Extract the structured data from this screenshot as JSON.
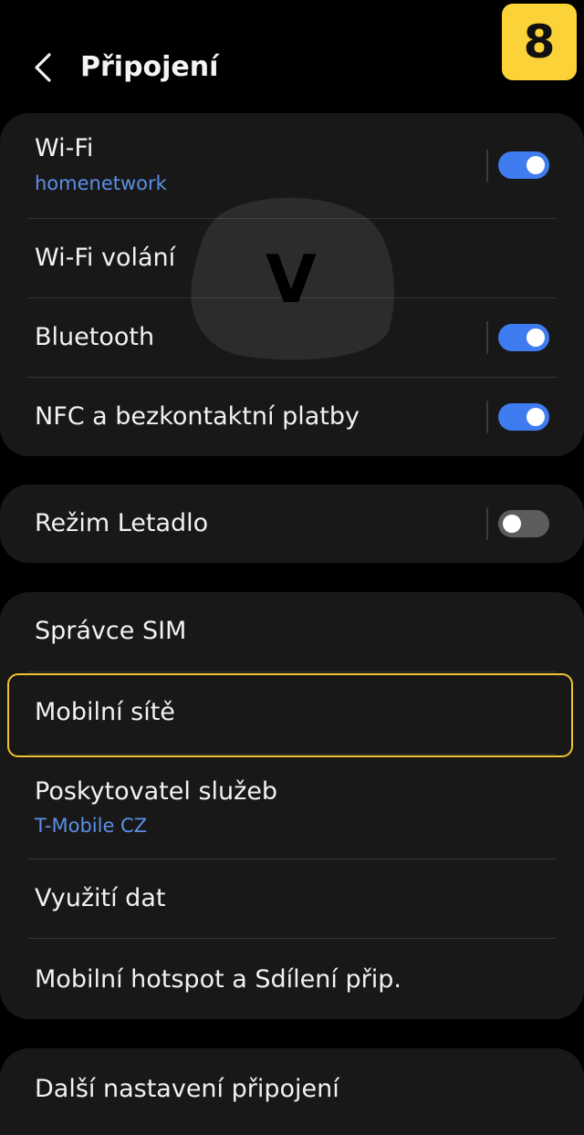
{
  "colors": {
    "background": "#000000",
    "card": "#181818",
    "accent_blue": "#3f7cf0",
    "subtext_blue": "#5b8fe6",
    "toggle_off": "#5c5c5c",
    "highlight": "#f2c232",
    "badge": "#fbd338"
  },
  "header": {
    "back_icon": "chevron-left-icon",
    "title": "Připojení"
  },
  "badge": {
    "step": "8"
  },
  "watermark": {
    "letter": "V"
  },
  "groups": [
    {
      "items": [
        {
          "label": "Wi-Fi",
          "sublabel": "homenetwork",
          "toggle": "on"
        },
        {
          "label": "Wi-Fi volání"
        },
        {
          "label": "Bluetooth",
          "toggle": "on"
        },
        {
          "label": "NFC a bezkontaktní platby",
          "toggle": "on"
        }
      ]
    },
    {
      "items": [
        {
          "label": "Režim Letadlo",
          "toggle": "off"
        }
      ]
    },
    {
      "items": [
        {
          "label": "Správce SIM"
        },
        {
          "label": "Mobilní sítě",
          "highlighted": true
        },
        {
          "label": "Poskytovatel služeb",
          "sublabel": "T-Mobile CZ"
        },
        {
          "label": "Využití dat"
        },
        {
          "label": "Mobilní hotspot a Sdílení přip."
        }
      ]
    },
    {
      "items": [
        {
          "label": "Další nastavení připojení"
        }
      ]
    }
  ]
}
